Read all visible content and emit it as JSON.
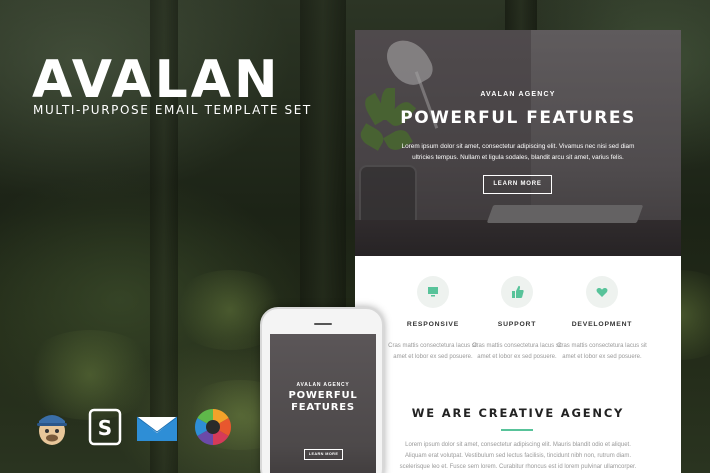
{
  "brand": {
    "title": "AVALAN",
    "subtitle": "MULTI-PURPOSE EMAIL TEMPLATE SET"
  },
  "desktop_email": {
    "hero": {
      "eyebrow": "AVALAN AGENCY",
      "title": "POWERFUL FEATURES",
      "text": "Lorem ipsum dolor sit amet, consectetur adipiscing elit. Vivamus nec nisi sed diam ultricies tempus. Nullam et ligula sodales, blandit arcu sit amet, varius felis.",
      "button_label": "LEARN MORE"
    },
    "features": [
      {
        "icon": "monitor-icon",
        "label": "RESPONSIVE",
        "desc": "Cras mattis consectetura lacus sit amet et lobor ex sed posuere."
      },
      {
        "icon": "thumbs-up-icon",
        "label": "SUPPORT",
        "desc": "Cras mattis consectetura lacus sit amet et lobor ex sed posuere."
      },
      {
        "icon": "heart-icon",
        "label": "DEVELOPMENT",
        "desc": "Cras mattis consectetura lacus sit amet et lobor ex sed posuere."
      }
    ],
    "agency": {
      "title": "WE ARE CREATIVE AGENCY",
      "text": "Lorem ipsum dolor sit amet, consectetur adipiscing elit. Mauris blandit odio et aliquet. Aliquam erat volutpat. Vestibulum sed lectus facilisis, tincidunt nibh non, rutrum diam. scelerisque leo et. Fusce sem lorem. Curabitur rhoncus est id lorem pulvinar ullamcorper."
    }
  },
  "mobile_email": {
    "eyebrow": "AVALAN AGENCY",
    "title_line1": "POWERFUL",
    "title_line2": "FEATURES",
    "button_label": "LEARN MORE"
  },
  "compatibility_icons": [
    "mailchimp-icon",
    "stamplia-icon",
    "campaign-monitor-icon",
    "color-wheel-icon"
  ],
  "colors": {
    "accent": "#58c39a",
    "hero_bg": "#544f51",
    "background": "#1d2418"
  }
}
